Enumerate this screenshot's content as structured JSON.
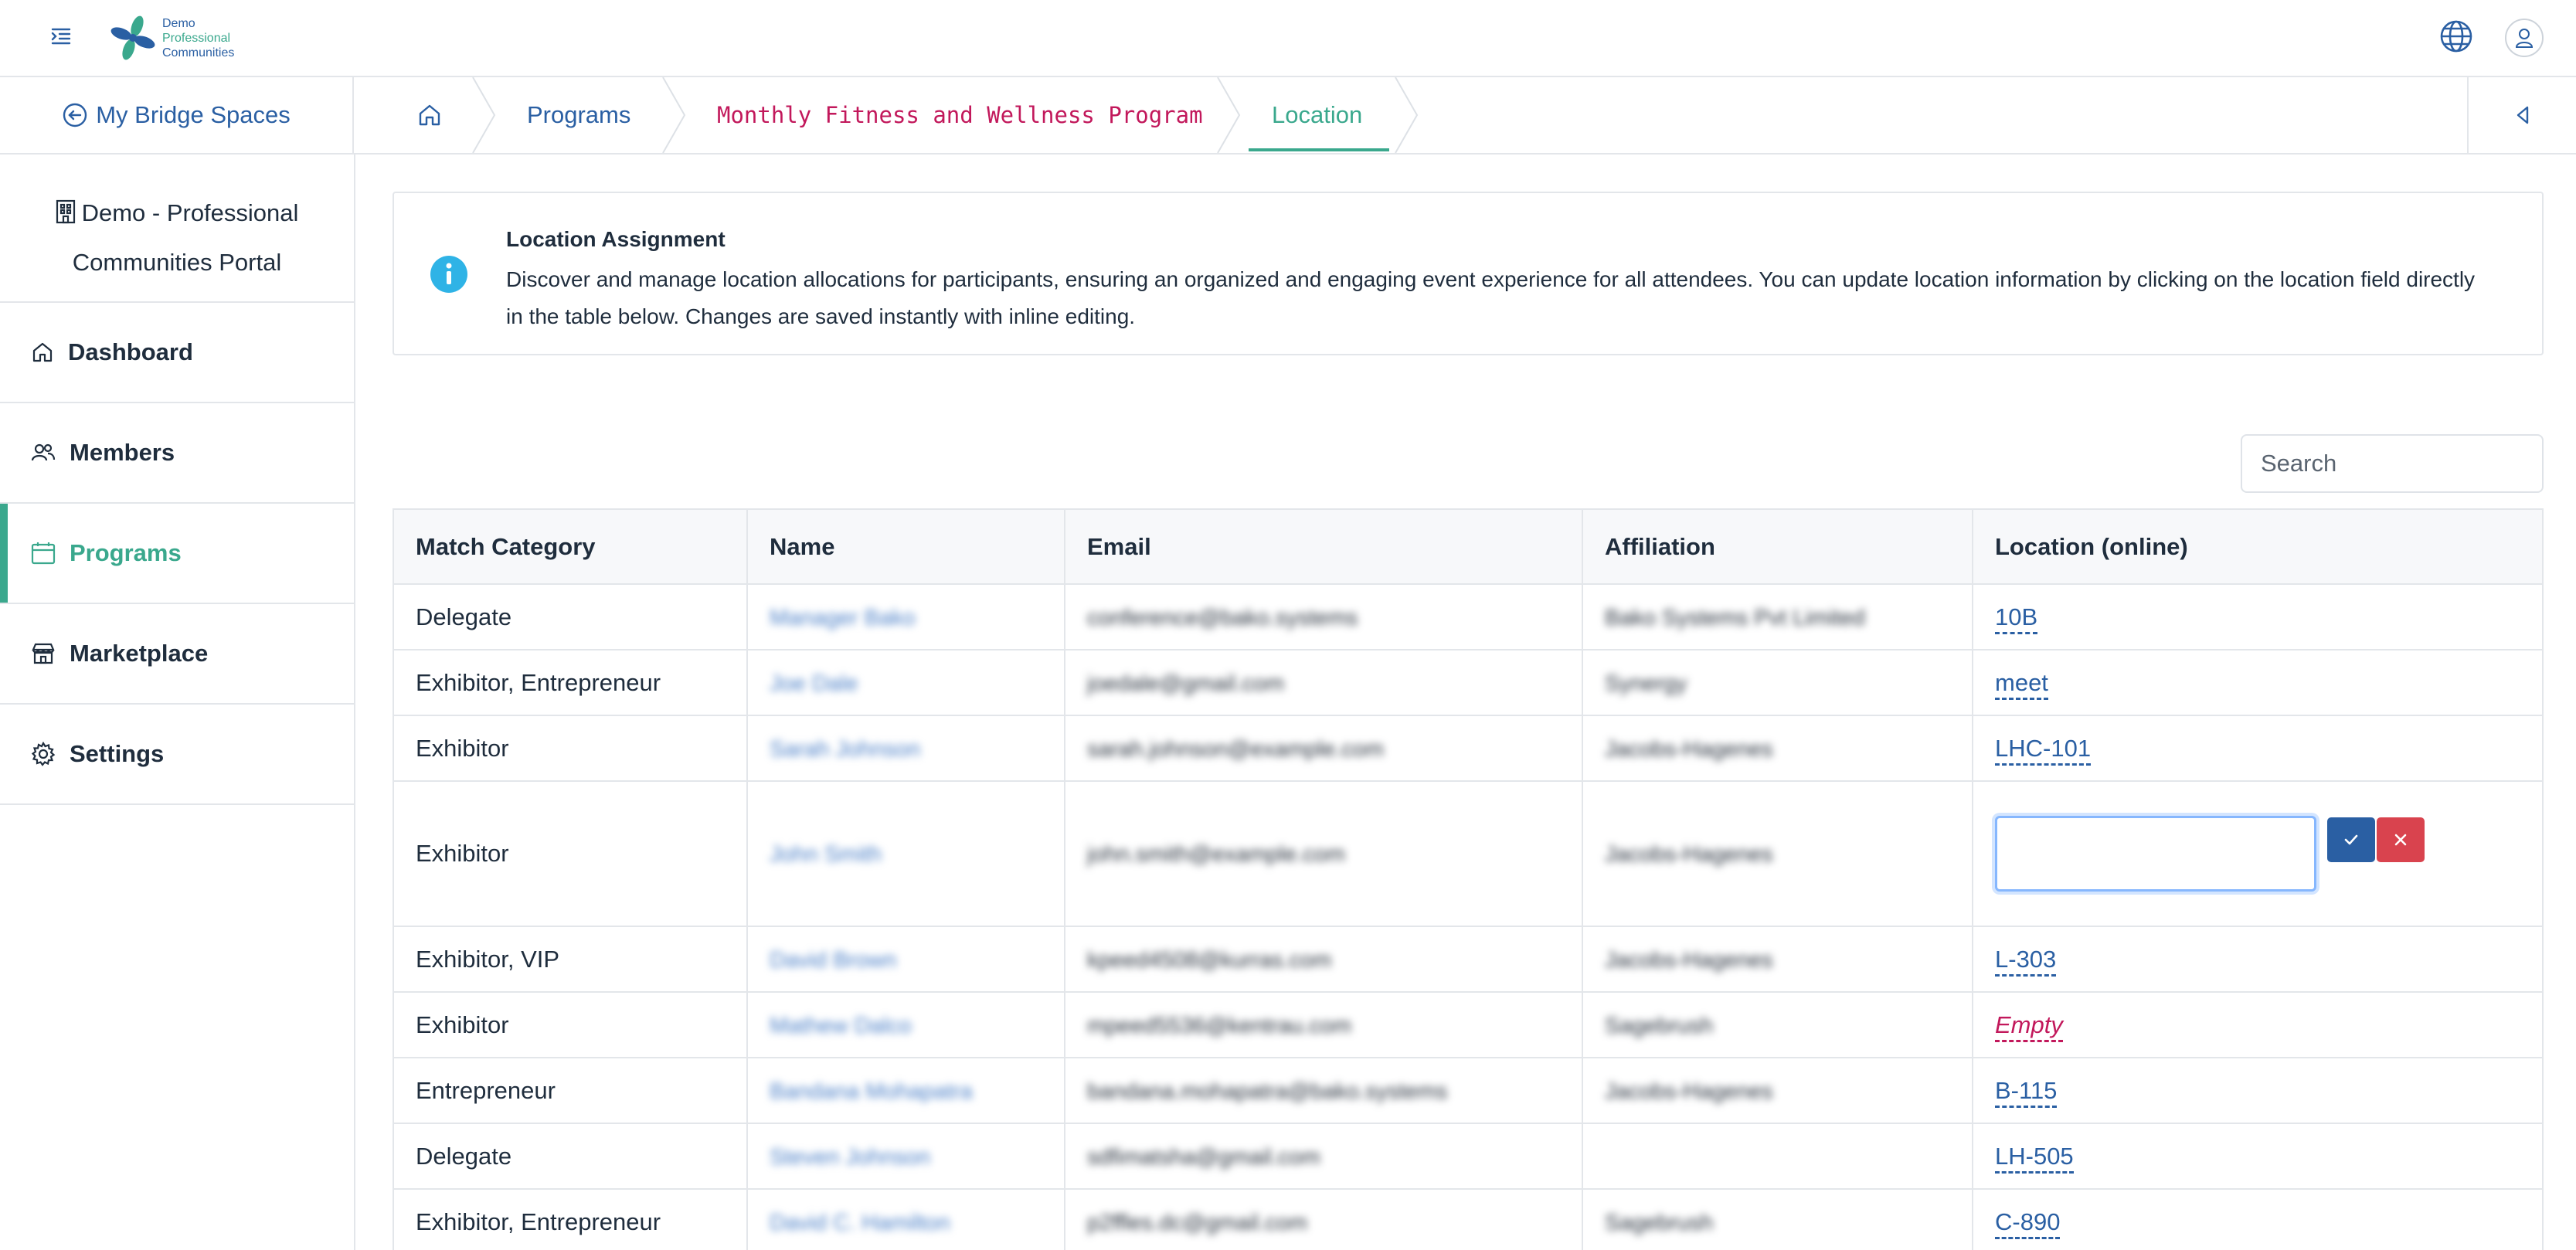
{
  "header": {
    "logo_lines": [
      "Demo",
      "Professional",
      "Communities"
    ],
    "hamburger_icon": "indent-menu-icon",
    "globe_icon": "globe-icon",
    "user_icon": "user-icon"
  },
  "breadcrumb": {
    "back_label": "My Bridge Spaces",
    "home_icon": "home-icon",
    "items": [
      "Programs",
      "Monthly Fitness and Wellness Program",
      "Location"
    ]
  },
  "sidebar": {
    "portal_line1": "Demo - Professional",
    "portal_line2": "Communities Portal",
    "items": [
      {
        "label": "Dashboard",
        "icon": "home-icon"
      },
      {
        "label": "Members",
        "icon": "users-icon"
      },
      {
        "label": "Programs",
        "icon": "calendar-icon",
        "active": true
      },
      {
        "label": "Marketplace",
        "icon": "store-icon"
      },
      {
        "label": "Settings",
        "icon": "gear-icon"
      }
    ]
  },
  "info": {
    "title": "Location Assignment",
    "body": "Discover and manage location allocations for participants, ensuring an organized and engaging event experience for all attendees. You can update location information by clicking on the location field directly in the table below. Changes are saved instantly with inline editing."
  },
  "search": {
    "placeholder": "Search"
  },
  "table": {
    "headers": [
      "Match Category",
      "Name",
      "Email",
      "Affiliation",
      "Location (online)"
    ],
    "rows": [
      {
        "category": "Delegate",
        "name": "Manager Bako",
        "email": "conference@bako.systems",
        "affiliation": "Bako Systems Pvt Limited",
        "location": "10B"
      },
      {
        "category": "Exhibitor, Entrepreneur",
        "name": "Joe Dale",
        "email": "joedale@gmail.com",
        "affiliation": "Synergy",
        "location": "meet"
      },
      {
        "category": "Exhibitor",
        "name": "Sarah Johnson",
        "email": "sarah.johnson@example.com",
        "affiliation": "Jacobs-Hagenes",
        "location": "LHC-101"
      },
      {
        "category": "Exhibitor",
        "name": "John Smith",
        "email": "john.smith@example.com",
        "affiliation": "Jacobs-Hagenes",
        "location": "",
        "editing": true
      },
      {
        "category": "Exhibitor, VIP",
        "name": "David Brown",
        "email": "kpeed4508@kurras.com",
        "affiliation": "Jacobs-Hagenes",
        "location": "L-303"
      },
      {
        "category": "Exhibitor",
        "name": "Mathew Dalco",
        "email": "mpeed5536@kentrau.com",
        "affiliation": "Sagebrush",
        "location": "Empty",
        "empty": true
      },
      {
        "category": "Entrepreneur",
        "name": "Bandana Mohapatra",
        "email": "bandana.mohapatra@bako.systems",
        "affiliation": "Jacobs-Hagenes",
        "location": "B-115"
      },
      {
        "category": "Delegate",
        "name": "Steven Johnson",
        "email": "sdfimatsha@gmail.com",
        "affiliation": "",
        "location": "LH-505"
      },
      {
        "category": "Exhibitor, Entrepreneur",
        "name": "David C. Hamilton",
        "email": "p2ffles.dc@gmail.com",
        "affiliation": "Sagebrush",
        "location": "C-890"
      }
    ]
  }
}
